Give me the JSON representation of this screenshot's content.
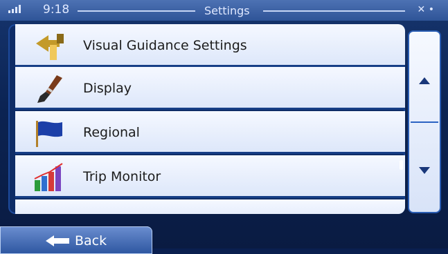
{
  "status_bar": {
    "time": "9:18",
    "title": "Settings"
  },
  "menu": {
    "items": [
      {
        "label": "Visual Guidance Settings",
        "icon": "visual-guidance-icon"
      },
      {
        "label": "Display",
        "icon": "paintbrush-icon"
      },
      {
        "label": "Regional",
        "icon": "flag-icon"
      },
      {
        "label": "Trip Monitor",
        "icon": "bar-chart-icon"
      }
    ]
  },
  "scroll": {
    "up_icon": "arrow-up-icon",
    "down_icon": "arrow-down-icon"
  },
  "footer": {
    "back_label": "Back",
    "back_icon": "arrow-left-icon"
  }
}
